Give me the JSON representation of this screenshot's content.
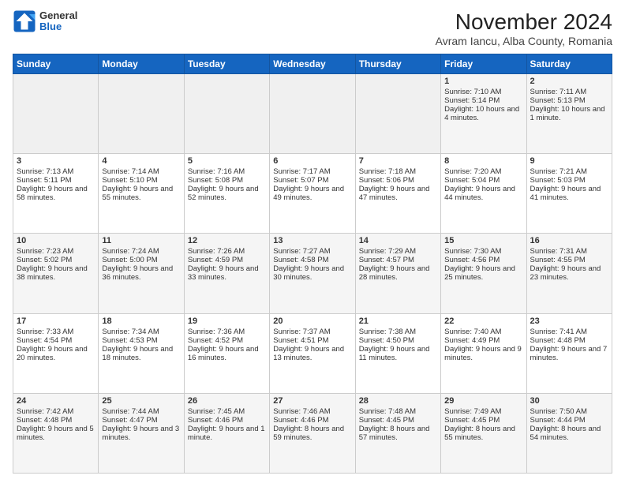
{
  "header": {
    "logo": {
      "general": "General",
      "blue": "Blue"
    },
    "title": "November 2024",
    "subtitle": "Avram Iancu, Alba County, Romania"
  },
  "calendar": {
    "headers": [
      "Sunday",
      "Monday",
      "Tuesday",
      "Wednesday",
      "Thursday",
      "Friday",
      "Saturday"
    ],
    "rows": [
      [
        {
          "day": "",
          "sunrise": "",
          "sunset": "",
          "daylight": ""
        },
        {
          "day": "",
          "sunrise": "",
          "sunset": "",
          "daylight": ""
        },
        {
          "day": "",
          "sunrise": "",
          "sunset": "",
          "daylight": ""
        },
        {
          "day": "",
          "sunrise": "",
          "sunset": "",
          "daylight": ""
        },
        {
          "day": "",
          "sunrise": "",
          "sunset": "",
          "daylight": ""
        },
        {
          "day": "1",
          "sunrise": "Sunrise: 7:10 AM",
          "sunset": "Sunset: 5:14 PM",
          "daylight": "Daylight: 10 hours and 4 minutes."
        },
        {
          "day": "2",
          "sunrise": "Sunrise: 7:11 AM",
          "sunset": "Sunset: 5:13 PM",
          "daylight": "Daylight: 10 hours and 1 minute."
        }
      ],
      [
        {
          "day": "3",
          "sunrise": "Sunrise: 7:13 AM",
          "sunset": "Sunset: 5:11 PM",
          "daylight": "Daylight: 9 hours and 58 minutes."
        },
        {
          "day": "4",
          "sunrise": "Sunrise: 7:14 AM",
          "sunset": "Sunset: 5:10 PM",
          "daylight": "Daylight: 9 hours and 55 minutes."
        },
        {
          "day": "5",
          "sunrise": "Sunrise: 7:16 AM",
          "sunset": "Sunset: 5:08 PM",
          "daylight": "Daylight: 9 hours and 52 minutes."
        },
        {
          "day": "6",
          "sunrise": "Sunrise: 7:17 AM",
          "sunset": "Sunset: 5:07 PM",
          "daylight": "Daylight: 9 hours and 49 minutes."
        },
        {
          "day": "7",
          "sunrise": "Sunrise: 7:18 AM",
          "sunset": "Sunset: 5:06 PM",
          "daylight": "Daylight: 9 hours and 47 minutes."
        },
        {
          "day": "8",
          "sunrise": "Sunrise: 7:20 AM",
          "sunset": "Sunset: 5:04 PM",
          "daylight": "Daylight: 9 hours and 44 minutes."
        },
        {
          "day": "9",
          "sunrise": "Sunrise: 7:21 AM",
          "sunset": "Sunset: 5:03 PM",
          "daylight": "Daylight: 9 hours and 41 minutes."
        }
      ],
      [
        {
          "day": "10",
          "sunrise": "Sunrise: 7:23 AM",
          "sunset": "Sunset: 5:02 PM",
          "daylight": "Daylight: 9 hours and 38 minutes."
        },
        {
          "day": "11",
          "sunrise": "Sunrise: 7:24 AM",
          "sunset": "Sunset: 5:00 PM",
          "daylight": "Daylight: 9 hours and 36 minutes."
        },
        {
          "day": "12",
          "sunrise": "Sunrise: 7:26 AM",
          "sunset": "Sunset: 4:59 PM",
          "daylight": "Daylight: 9 hours and 33 minutes."
        },
        {
          "day": "13",
          "sunrise": "Sunrise: 7:27 AM",
          "sunset": "Sunset: 4:58 PM",
          "daylight": "Daylight: 9 hours and 30 minutes."
        },
        {
          "day": "14",
          "sunrise": "Sunrise: 7:29 AM",
          "sunset": "Sunset: 4:57 PM",
          "daylight": "Daylight: 9 hours and 28 minutes."
        },
        {
          "day": "15",
          "sunrise": "Sunrise: 7:30 AM",
          "sunset": "Sunset: 4:56 PM",
          "daylight": "Daylight: 9 hours and 25 minutes."
        },
        {
          "day": "16",
          "sunrise": "Sunrise: 7:31 AM",
          "sunset": "Sunset: 4:55 PM",
          "daylight": "Daylight: 9 hours and 23 minutes."
        }
      ],
      [
        {
          "day": "17",
          "sunrise": "Sunrise: 7:33 AM",
          "sunset": "Sunset: 4:54 PM",
          "daylight": "Daylight: 9 hours and 20 minutes."
        },
        {
          "day": "18",
          "sunrise": "Sunrise: 7:34 AM",
          "sunset": "Sunset: 4:53 PM",
          "daylight": "Daylight: 9 hours and 18 minutes."
        },
        {
          "day": "19",
          "sunrise": "Sunrise: 7:36 AM",
          "sunset": "Sunset: 4:52 PM",
          "daylight": "Daylight: 9 hours and 16 minutes."
        },
        {
          "day": "20",
          "sunrise": "Sunrise: 7:37 AM",
          "sunset": "Sunset: 4:51 PM",
          "daylight": "Daylight: 9 hours and 13 minutes."
        },
        {
          "day": "21",
          "sunrise": "Sunrise: 7:38 AM",
          "sunset": "Sunset: 4:50 PM",
          "daylight": "Daylight: 9 hours and 11 minutes."
        },
        {
          "day": "22",
          "sunrise": "Sunrise: 7:40 AM",
          "sunset": "Sunset: 4:49 PM",
          "daylight": "Daylight: 9 hours and 9 minutes."
        },
        {
          "day": "23",
          "sunrise": "Sunrise: 7:41 AM",
          "sunset": "Sunset: 4:48 PM",
          "daylight": "Daylight: 9 hours and 7 minutes."
        }
      ],
      [
        {
          "day": "24",
          "sunrise": "Sunrise: 7:42 AM",
          "sunset": "Sunset: 4:48 PM",
          "daylight": "Daylight: 9 hours and 5 minutes."
        },
        {
          "day": "25",
          "sunrise": "Sunrise: 7:44 AM",
          "sunset": "Sunset: 4:47 PM",
          "daylight": "Daylight: 9 hours and 3 minutes."
        },
        {
          "day": "26",
          "sunrise": "Sunrise: 7:45 AM",
          "sunset": "Sunset: 4:46 PM",
          "daylight": "Daylight: 9 hours and 1 minute."
        },
        {
          "day": "27",
          "sunrise": "Sunrise: 7:46 AM",
          "sunset": "Sunset: 4:46 PM",
          "daylight": "Daylight: 8 hours and 59 minutes."
        },
        {
          "day": "28",
          "sunrise": "Sunrise: 7:48 AM",
          "sunset": "Sunset: 4:45 PM",
          "daylight": "Daylight: 8 hours and 57 minutes."
        },
        {
          "day": "29",
          "sunrise": "Sunrise: 7:49 AM",
          "sunset": "Sunset: 4:45 PM",
          "daylight": "Daylight: 8 hours and 55 minutes."
        },
        {
          "day": "30",
          "sunrise": "Sunrise: 7:50 AM",
          "sunset": "Sunset: 4:44 PM",
          "daylight": "Daylight: 8 hours and 54 minutes."
        }
      ]
    ]
  }
}
